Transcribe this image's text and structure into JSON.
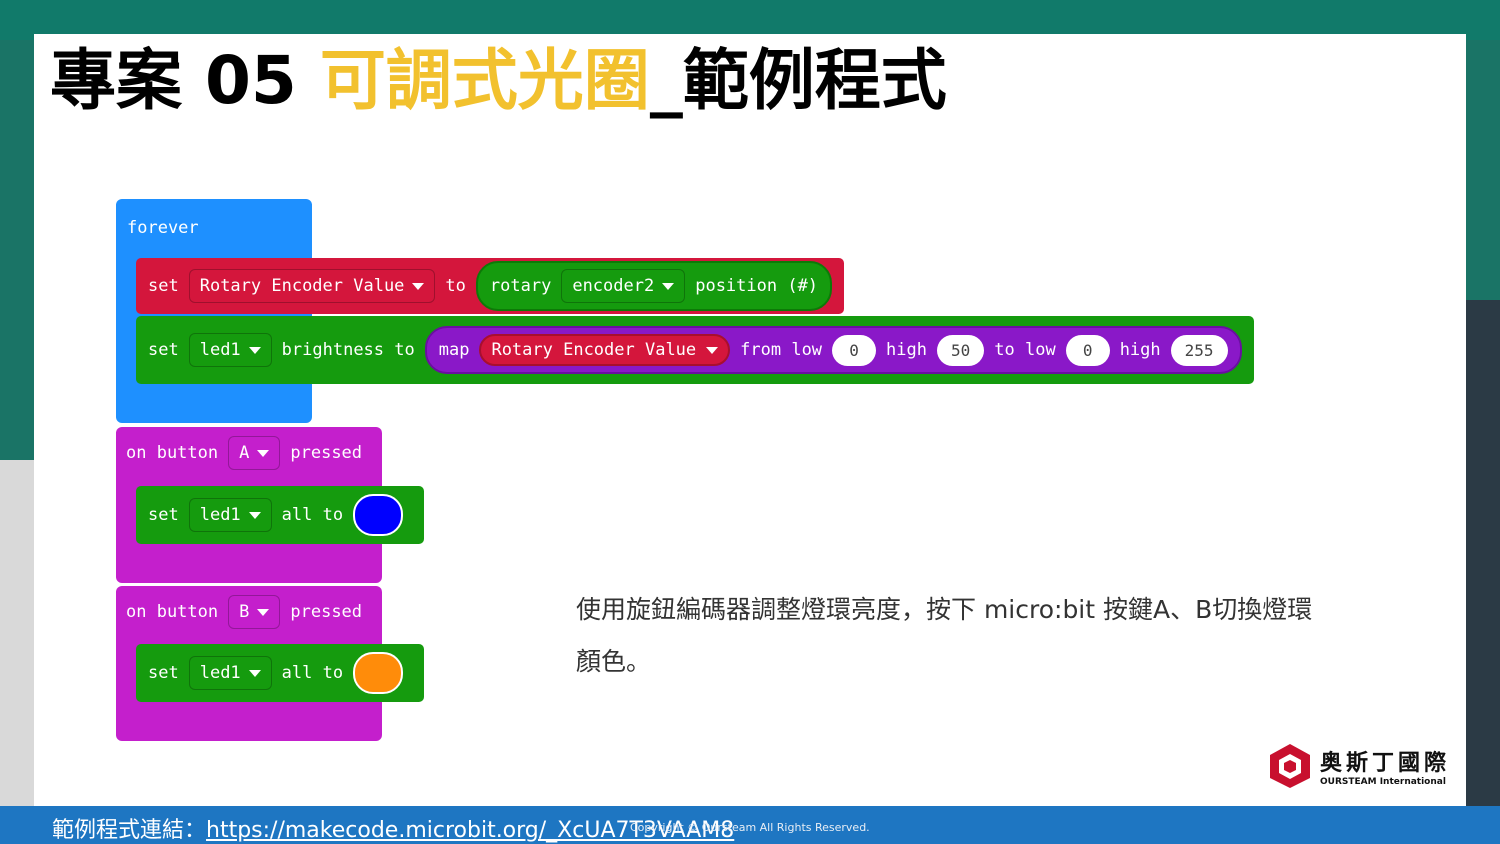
{
  "title": {
    "prefix": "專案 05 ",
    "highlight": "可調式光圈",
    "suffix": "_範例程式"
  },
  "blocks": {
    "forever": {
      "label": "forever",
      "set1": {
        "set": "set",
        "variable": "Rotary Encoder Value",
        "to": "to",
        "func": "rotary",
        "device": "encoder2",
        "prop": "position (#)"
      },
      "set2": {
        "set": "set",
        "variable": "led1",
        "text": "brightness to",
        "map": "map",
        "map_var": "Rotary Encoder Value",
        "from_low": "from low",
        "from_low_val": "0",
        "high": "high",
        "high_val": "50",
        "to_low": "to low",
        "to_low_val": "0",
        "high2": "high",
        "high2_val": "255"
      }
    },
    "button_a": {
      "on": "on button",
      "button": "A",
      "pressed": "pressed",
      "set": "set",
      "variable": "led1",
      "all_to": "all to",
      "color": "#0000ff"
    },
    "button_b": {
      "on": "on button",
      "button": "B",
      "pressed": "pressed",
      "set": "set",
      "variable": "led1",
      "all_to": "all to",
      "color": "#ff8c0a"
    }
  },
  "description": "使用旋鈕編碼器調整燈環亮度，按下  micro:bit 按鍵A、B切換燈環顏色。",
  "logo": {
    "name_cn": "奥斯丁國際",
    "name_en": "OURSTEAM International"
  },
  "footer": {
    "label": "範例程式連結：",
    "link": "https://makecode.microbit.org/_XcUA7T3VAAM8",
    "copyright": "Copyright © Oursteam All Rights Reserved."
  },
  "colors": {
    "hat": "#1e90ff",
    "red": "#d4163c",
    "green": "#159b0e",
    "purple": "#c41fcc",
    "map": "#8a18c8",
    "highlight": "#f2c12e"
  }
}
